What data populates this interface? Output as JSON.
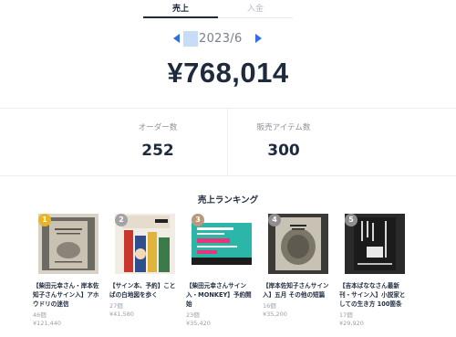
{
  "tabs": {
    "sales": "売上",
    "deposit": "入金"
  },
  "period": {
    "month": "2023/6"
  },
  "summary": {
    "total_sales": "¥768,014",
    "orders_label": "オーダー数",
    "orders_value": "252",
    "items_sold_label": "販売アイテム数",
    "items_sold_value": "300"
  },
  "ranking": {
    "title": "売上ランキング",
    "badge_colors": [
      "#e8b528",
      "#a3a3a3",
      "#b9987d",
      "#8e8e8e",
      "#8e8e8e"
    ],
    "items": [
      {
        "rank": "1",
        "title": "【柴田元幸さん・岸本佐知子さんサイン入】アホウドリの迷信",
        "count": "46個",
        "amount": "¥121,440"
      },
      {
        "rank": "2",
        "title": "【サイン本、予約】ことばの白地図を歩く",
        "count": "27個",
        "amount": "¥41,580"
      },
      {
        "rank": "3",
        "title": "【柴田元幸さんサイン入・MONKEY】予約開始",
        "count": "23個",
        "amount": "¥35,420"
      },
      {
        "rank": "4",
        "title": "【岸本佐知子さんサイン入】五月 その他の短篇",
        "count": "16個",
        "amount": "¥35,200"
      },
      {
        "rank": "5",
        "title": "【吉本ばななさん最新刊・サイン入】小説家としての生き方 100箇条",
        "count": "17個",
        "amount": "¥29,920"
      }
    ]
  }
}
